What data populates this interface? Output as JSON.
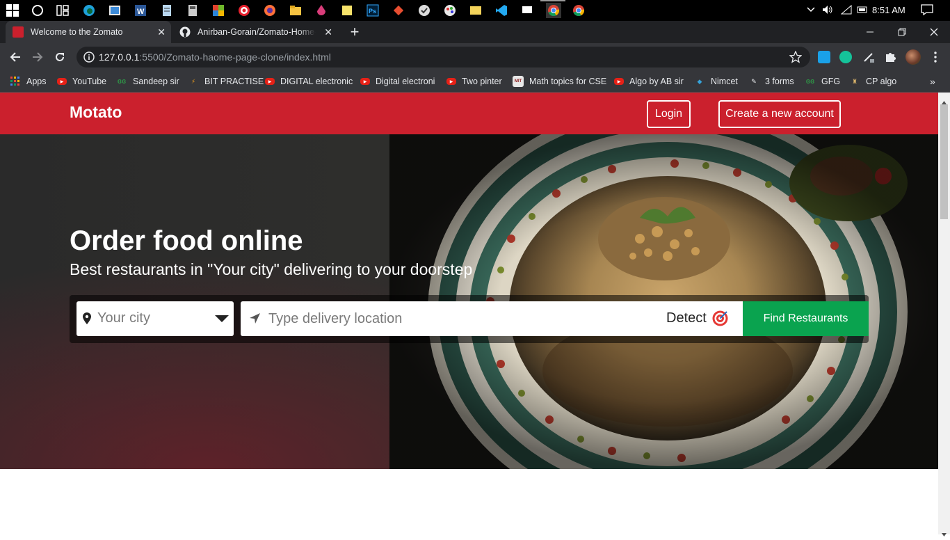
{
  "taskbar": {
    "clock": "8:51 AM"
  },
  "tabs": [
    {
      "title": "Welcome to the Zomato",
      "active": true
    },
    {
      "title": "Anirban-Gorain/Zomato-Home-P",
      "active": false
    }
  ],
  "address_bar": {
    "host": "127.0.0.1",
    "path": ":5500/Zomato-haome-page-clone/index.html"
  },
  "bookmarks": [
    {
      "label": "Apps",
      "icon": "apps-grid-icon"
    },
    {
      "label": "YouTube",
      "icon": "youtube-icon"
    },
    {
      "label": "Sandeep sir",
      "icon": "gfg-icon"
    },
    {
      "label": "BIT PRACTISE",
      "icon": "practice-icon"
    },
    {
      "label": "DIGITAL electronic",
      "icon": "youtube-icon"
    },
    {
      "label": "Digital electroni",
      "icon": "youtube-icon"
    },
    {
      "label": "Two pinter",
      "icon": "youtube-icon"
    },
    {
      "label": "Math topics for CSE",
      "icon": "mit-icon"
    },
    {
      "label": "Algo by AB sir",
      "icon": "youtube-icon"
    },
    {
      "label": "Nimcet",
      "icon": "nimcet-icon"
    },
    {
      "label": "3 forms",
      "icon": "forms-icon"
    },
    {
      "label": "GFG",
      "icon": "gfg-icon"
    },
    {
      "label": "CP algo",
      "icon": "cp-algo-icon"
    }
  ],
  "site": {
    "brand": "Motato",
    "login": "Login",
    "signup": "Create a new account",
    "hero_title": "Order food online",
    "hero_subtitle": "Best restaurants in \"Your city\" delivering to your doorstep",
    "city_placeholder": "Your city",
    "location_placeholder": "Type delivery location",
    "detect": "Detect",
    "find_button": "Find Restaurants"
  },
  "colors": {
    "brand_red": "#cb202d",
    "find_green": "#0aa34f"
  }
}
